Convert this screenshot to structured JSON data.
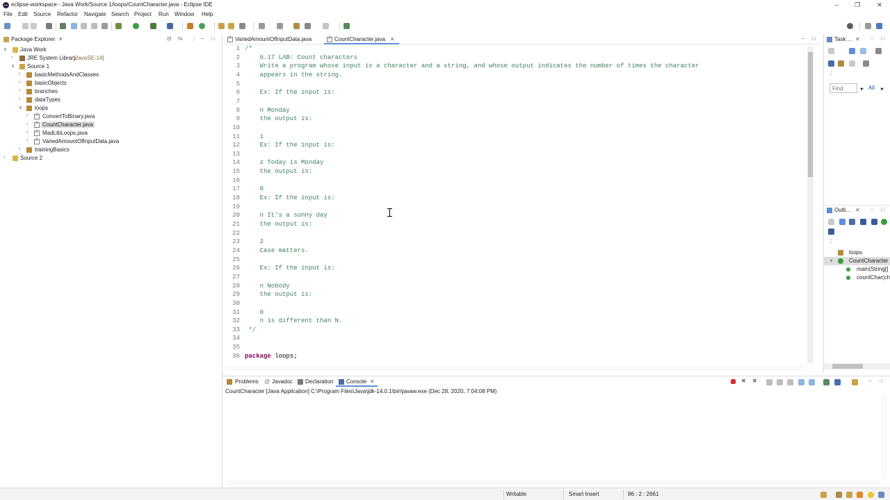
{
  "window": {
    "title": "eclipse-workspace - Java Work/Source 1/loops/CountCharacter.java - Eclipse IDE"
  },
  "menu": [
    "File",
    "Edit",
    "Source",
    "Refactor",
    "Navigate",
    "Search",
    "Project",
    "Run",
    "Window",
    "Help"
  ],
  "package_explorer": {
    "tab_label": "Package Explorer",
    "tree": [
      {
        "label": "Java Work",
        "icon": "project-icon",
        "expanded": true
      },
      {
        "label": "JRE System Library",
        "suffix": "[JavaSE-14]",
        "icon": "library-icon",
        "expanded": false
      },
      {
        "label": "Source 1",
        "icon": "source-folder-icon",
        "expanded": true
      },
      {
        "label": "basicMethodsAndClasses",
        "icon": "package-icon",
        "expanded": false
      },
      {
        "label": "basicObjects",
        "icon": "package-icon",
        "expanded": false
      },
      {
        "label": "branches",
        "icon": "package-icon",
        "expanded": false
      },
      {
        "label": "dataTypes",
        "icon": "package-icon",
        "expanded": false
      },
      {
        "label": "loops",
        "icon": "package-icon",
        "expanded": true
      },
      {
        "label": "ConvertToBinary.java",
        "icon": "java-file-icon",
        "expanded": false
      },
      {
        "label": "CountCharacter.java",
        "icon": "java-file-icon",
        "expanded": false,
        "selected": true
      },
      {
        "label": "MadLibLoops.java",
        "icon": "java-file-icon",
        "expanded": false
      },
      {
        "label": "VariedAmountOfInputData.java",
        "icon": "java-file-icon",
        "expanded": false
      },
      {
        "label": "trainingBasics",
        "icon": "package-icon",
        "expanded": false
      },
      {
        "label": "Source 2",
        "icon": "source-folder-icon",
        "expanded": false
      }
    ]
  },
  "editor": {
    "tabs": [
      {
        "label": "VariedAmountOfInputData.java",
        "active": false
      },
      {
        "label": "CountCharacter.java",
        "active": true
      }
    ],
    "lines": [
      {
        "n": "1",
        "segments": [
          {
            "t": "/*",
            "c": "comment"
          }
        ]
      },
      {
        "n": "2",
        "segments": [
          {
            "t": "    6.17 LAB: Count characters",
            "c": "comment"
          }
        ]
      },
      {
        "n": "3",
        "segments": [
          {
            "t": "    Write a program whose input is a character and a string, and whose output indicates the number of times the character",
            "c": "comment"
          }
        ]
      },
      {
        "n": "4",
        "segments": [
          {
            "t": "    appears in the string.",
            "c": "comment"
          }
        ]
      },
      {
        "n": "5",
        "segments": []
      },
      {
        "n": "6",
        "segments": [
          {
            "t": "    Ex: If the input is:",
            "c": "comment"
          }
        ]
      },
      {
        "n": "7",
        "segments": []
      },
      {
        "n": "8",
        "segments": [
          {
            "t": "    n Monday",
            "c": "comment"
          }
        ]
      },
      {
        "n": "9",
        "segments": [
          {
            "t": "    the output is:",
            "c": "comment"
          }
        ]
      },
      {
        "n": "10",
        "segments": []
      },
      {
        "n": "11",
        "segments": [
          {
            "t": "    1",
            "c": "comment"
          }
        ]
      },
      {
        "n": "12",
        "segments": [
          {
            "t": "    Ex: If the input is:",
            "c": "comment"
          }
        ]
      },
      {
        "n": "13",
        "segments": []
      },
      {
        "n": "14",
        "segments": [
          {
            "t": "    z Today is Monday",
            "c": "comment"
          }
        ]
      },
      {
        "n": "15",
        "segments": [
          {
            "t": "    the output is:",
            "c": "comment"
          }
        ]
      },
      {
        "n": "16",
        "segments": []
      },
      {
        "n": "17",
        "segments": [
          {
            "t": "    0",
            "c": "comment"
          }
        ]
      },
      {
        "n": "18",
        "segments": [
          {
            "t": "    Ex: If the input is:",
            "c": "comment"
          }
        ]
      },
      {
        "n": "19",
        "segments": []
      },
      {
        "n": "20",
        "segments": [
          {
            "t": "    n It's a sunny day",
            "c": "comment"
          }
        ]
      },
      {
        "n": "21",
        "segments": [
          {
            "t": "    the output is:",
            "c": "comment"
          }
        ]
      },
      {
        "n": "22",
        "segments": []
      },
      {
        "n": "23",
        "segments": [
          {
            "t": "    2",
            "c": "comment"
          }
        ]
      },
      {
        "n": "24",
        "segments": [
          {
            "t": "    Case matters.",
            "c": "comment"
          }
        ]
      },
      {
        "n": "25",
        "segments": []
      },
      {
        "n": "26",
        "segments": [
          {
            "t": "    Ex: If the input is:",
            "c": "comment"
          }
        ]
      },
      {
        "n": "27",
        "segments": []
      },
      {
        "n": "28",
        "segments": [
          {
            "t": "    n Nobody",
            "c": "comment"
          }
        ]
      },
      {
        "n": "29",
        "segments": [
          {
            "t": "    the output is:",
            "c": "comment"
          }
        ]
      },
      {
        "n": "30",
        "segments": []
      },
      {
        "n": "31",
        "segments": [
          {
            "t": "    0",
            "c": "comment"
          }
        ]
      },
      {
        "n": "32",
        "segments": [
          {
            "t": "    n is different than N.",
            "c": "comment"
          }
        ]
      },
      {
        "n": "33",
        "segments": [
          {
            "t": " */",
            "c": "comment"
          }
        ]
      },
      {
        "n": "34",
        "segments": []
      },
      {
        "n": "35",
        "segments": []
      },
      {
        "n": "36",
        "segments": [
          {
            "t": "package",
            "c": "keyword"
          },
          {
            "t": " loops;",
            "c": "plain"
          }
        ]
      }
    ]
  },
  "task_list": {
    "tab_label": "Task ...",
    "find_placeholder": "Find",
    "all_label": "All"
  },
  "outline": {
    "tab_label": "Outli...",
    "items": [
      {
        "label": "loops",
        "icon": "package-icon"
      },
      {
        "label": "CountCharacter",
        "icon": "class-icon",
        "selected": true
      },
      {
        "label": "main(String[]",
        "icon": "method-icon"
      },
      {
        "label": "countChar(ch",
        "icon": "method-icon"
      }
    ]
  },
  "bottom_panel": {
    "tabs": [
      {
        "label": "Problems",
        "icon": "problems-icon",
        "active": false
      },
      {
        "label": "Javadoc",
        "icon": "javadoc-icon",
        "active": false
      },
      {
        "label": "Declaration",
        "icon": "declaration-icon",
        "active": false
      },
      {
        "label": "Console",
        "icon": "console-icon",
        "active": true
      }
    ],
    "console_header": "CountCharacter [Java Application] C:\\Program Files\\Java\\jdk-14.0.1\\bin\\javaw.exe  (Dec 28, 2020, 7:04:08 PM)"
  },
  "status_bar": {
    "writable": "Writable",
    "insert_mode": "Smart Insert",
    "position": "86 : 2 : 2661"
  },
  "colors": {
    "comment": "#3f7f5f",
    "keyword": "#7f0055",
    "line_number": "#787878",
    "selection": "#dedede",
    "stop_button": "#d32f2f"
  }
}
